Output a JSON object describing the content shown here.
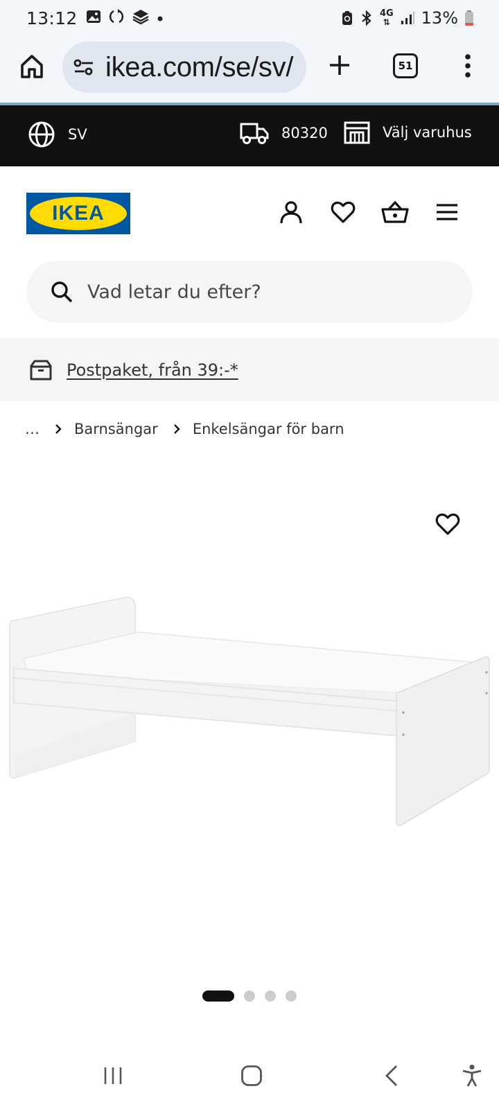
{
  "status_bar": {
    "time": "13:12",
    "battery_text": "13%",
    "network": "4G",
    "icons": [
      "image-icon",
      "sync-icon",
      "stack-icon",
      "dot-icon",
      "battery-saver-icon",
      "bluetooth-icon",
      "signal-icon",
      "battery-icon"
    ]
  },
  "browser": {
    "url": "ikea.com/se/sv/",
    "tab_count": "51"
  },
  "top_bar": {
    "language": "SV",
    "postcode": "80320",
    "store_label": "Välj varuhus"
  },
  "header": {
    "logo_text": "IKEA",
    "icons": [
      "account-icon",
      "heart-icon",
      "basket-icon",
      "menu-icon"
    ]
  },
  "search": {
    "placeholder": "Vad letar du efter?"
  },
  "promo": {
    "link_text": "Postpaket, från 39:-*"
  },
  "breadcrumb": {
    "items": [
      "…",
      "Barnsängar",
      "Enkelsängar för barn"
    ]
  },
  "gallery": {
    "image_count": 4,
    "active_index": 0
  },
  "colors": {
    "ikea_blue": "#0058a3",
    "ikea_yellow": "#ffdb00",
    "top_bar_bg": "#111111",
    "browser_bg": "#f3f6fb"
  }
}
